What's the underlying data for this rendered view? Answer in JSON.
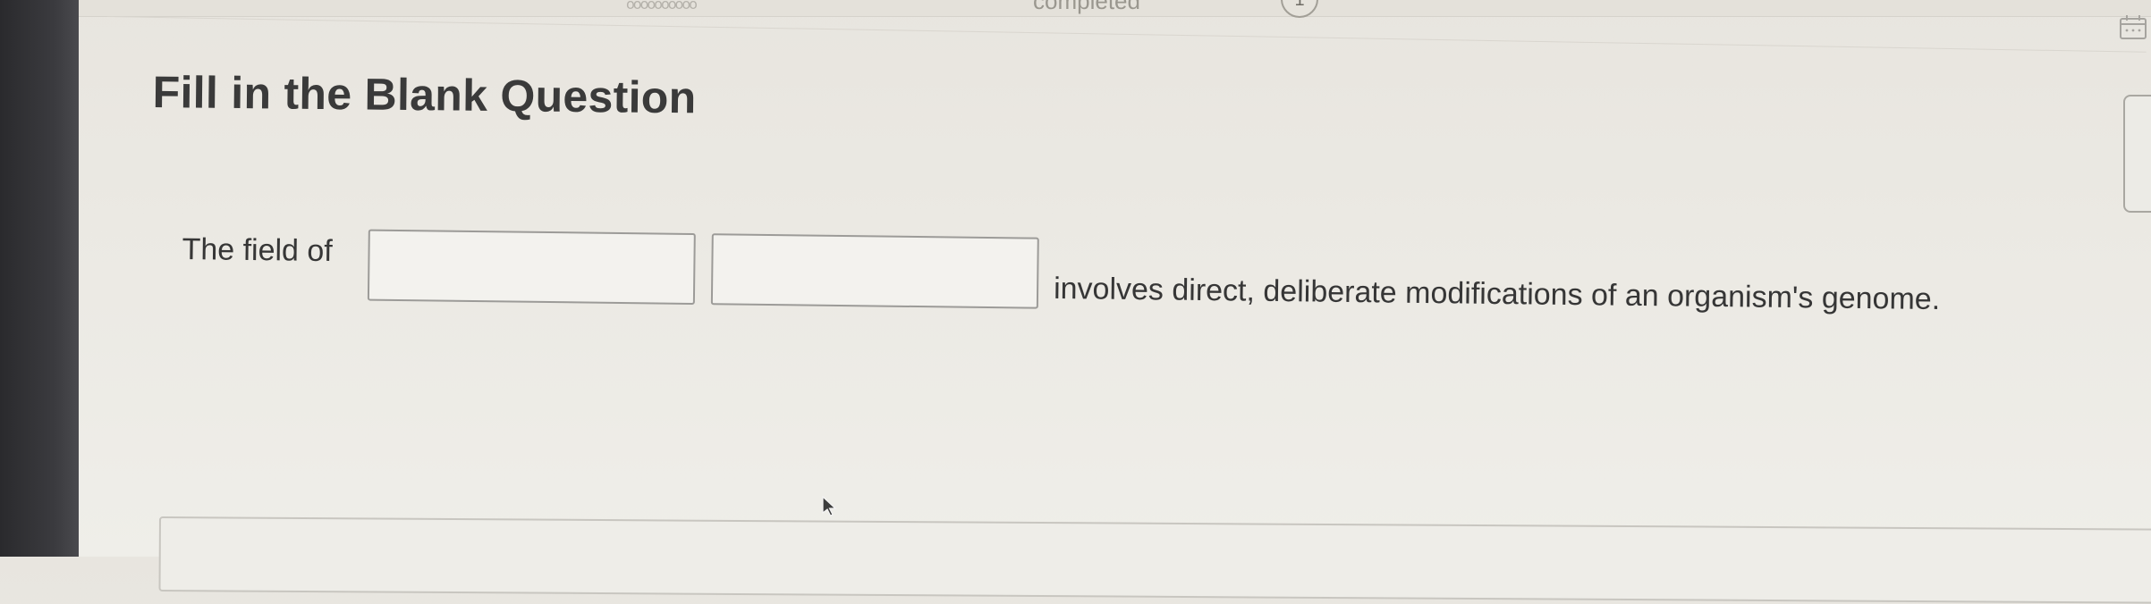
{
  "header": {
    "progress_dots": "oooooooooo",
    "completed_label": "completed",
    "completed_count": "1"
  },
  "question": {
    "title": "Fill in the Blank Question",
    "prefix": "The field of",
    "blank_1_value": "",
    "blank_2_value": "",
    "suffix": "involves direct, deliberate modifications of an organism's genome."
  },
  "icons": {
    "calendar": "calendar-icon",
    "cursor": "mouse-pointer-icon"
  },
  "colors": {
    "page_background": "#ebe9e3",
    "title_text": "#3a3a3a",
    "body_text": "#363636",
    "input_border": "#9c9b98"
  }
}
